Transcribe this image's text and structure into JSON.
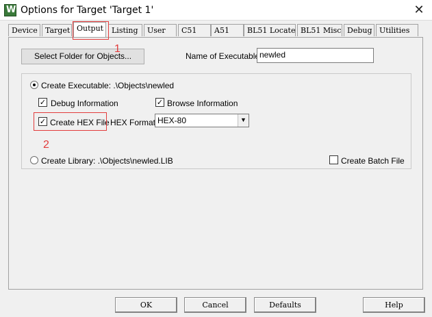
{
  "window": {
    "title": "Options for Target 'Target 1'",
    "close_glyph": "✕",
    "icon_letter": "W"
  },
  "tabs": [
    "Device",
    "Target",
    "Output",
    "Listing",
    "User",
    "C51",
    "A51",
    "BL51 Locate",
    "BL51 Misc",
    "Debug",
    "Utilities"
  ],
  "active_tab": "Output",
  "output": {
    "select_folder_label": "Select Folder for Objects...",
    "name_exec_label": "Name of Executable:",
    "name_exec_value": "newled",
    "create_exec_label": "Create Executable:  .\\Objects\\newled",
    "debug_info_label": "Debug Information",
    "browse_info_label": "Browse Information",
    "create_hex_label": "Create HEX File",
    "hex_format_label": "HEX Format:",
    "hex_format_value": "HEX-80",
    "create_lib_label": "Create Library:  .\\Objects\\newled.LIB",
    "create_batch_label": "Create Batch File",
    "create_exec_selected": true,
    "debug_info_checked": true,
    "browse_info_checked": true,
    "create_hex_checked": true,
    "create_batch_checked": false
  },
  "annotations": {
    "num1": "1",
    "num2": "2",
    "color": "#e23b3b"
  },
  "buttons": {
    "ok": "OK",
    "cancel": "Cancel",
    "defaults": "Defaults",
    "help": "Help"
  }
}
